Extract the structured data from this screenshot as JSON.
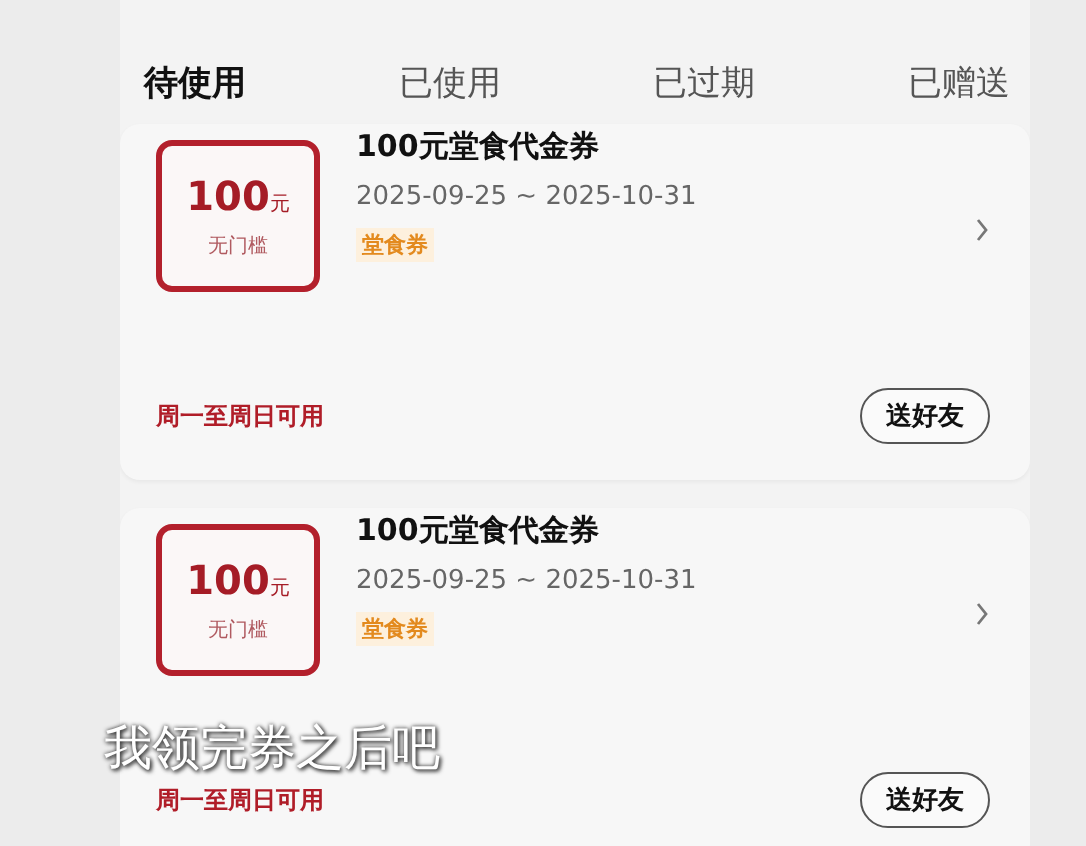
{
  "tabs": [
    {
      "label": "待使用",
      "selected": true
    },
    {
      "label": "已使用",
      "selected": false
    },
    {
      "label": "已过期",
      "selected": false
    },
    {
      "label": "已赠送",
      "selected": false
    }
  ],
  "coupons": [
    {
      "amount": "100",
      "unit": "元",
      "threshold": "无门槛",
      "title": "100元堂食代金券",
      "dates": "2025-09-25 ~ 2025-10-31",
      "tag": "堂食券",
      "availability": "周一至周日可用",
      "button": "送好友"
    },
    {
      "amount": "100",
      "unit": "元",
      "threshold": "无门槛",
      "title": "100元堂食代金券",
      "dates": "2025-09-25 ~ 2025-10-31",
      "tag": "堂食券",
      "availability": "周一至周日可用",
      "button": "送好友"
    }
  ],
  "caption": "我领完券之后吧"
}
